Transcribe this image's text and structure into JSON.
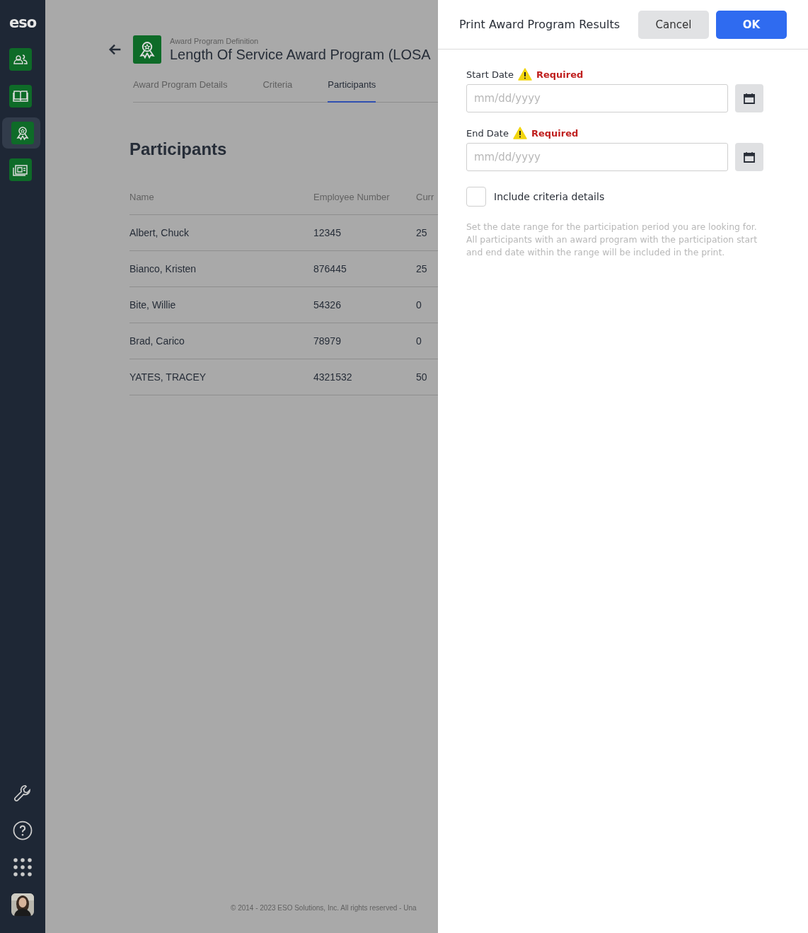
{
  "sidebar": {
    "logo": "eso",
    "nav_items": [
      {
        "selected": false
      },
      {
        "selected": false
      },
      {
        "selected": true
      },
      {
        "selected": false
      }
    ]
  },
  "page": {
    "subtitle": "Award Program Definition",
    "title": "Length Of Service Award Program (LOSA",
    "tabs": [
      {
        "label": "Award Program Details",
        "selected": false
      },
      {
        "label": "Criteria",
        "selected": false
      },
      {
        "label": "Participants",
        "selected": true
      }
    ],
    "section_title": "Participants",
    "table": {
      "columns": [
        "Name",
        "Employee Number",
        "Curr"
      ],
      "rows": [
        [
          "Albert, Chuck",
          "12345",
          "25"
        ],
        [
          "Bianco, Kristen",
          "876445",
          "25"
        ],
        [
          "Bite, Willie",
          "54326",
          "0"
        ],
        [
          "Brad, Carico",
          "78979",
          "0"
        ],
        [
          "YATES, TRACEY",
          "4321532",
          "50"
        ]
      ]
    },
    "footer": "© 2014 - 2023 ESO Solutions, Inc. All rights reserved - Una"
  },
  "drawer": {
    "title": "Print Award Program Results",
    "buttons": [
      {
        "label": "Cancel",
        "kind": "secondary"
      },
      {
        "label": "OK",
        "kind": "primary"
      }
    ],
    "fields": [
      {
        "label": "Start Date",
        "status": "Required",
        "placeholder": "mm/dd/yyyy"
      },
      {
        "label": "End Date",
        "status": "Required",
        "placeholder": "mm/dd/yyyy"
      }
    ],
    "checkbox": {
      "label": "Include criteria details",
      "checked": false
    },
    "help_text": "Set the date range for the participation period you are looking for. All participants with an award program with the participation start and end date within the range will be included in the print."
  }
}
